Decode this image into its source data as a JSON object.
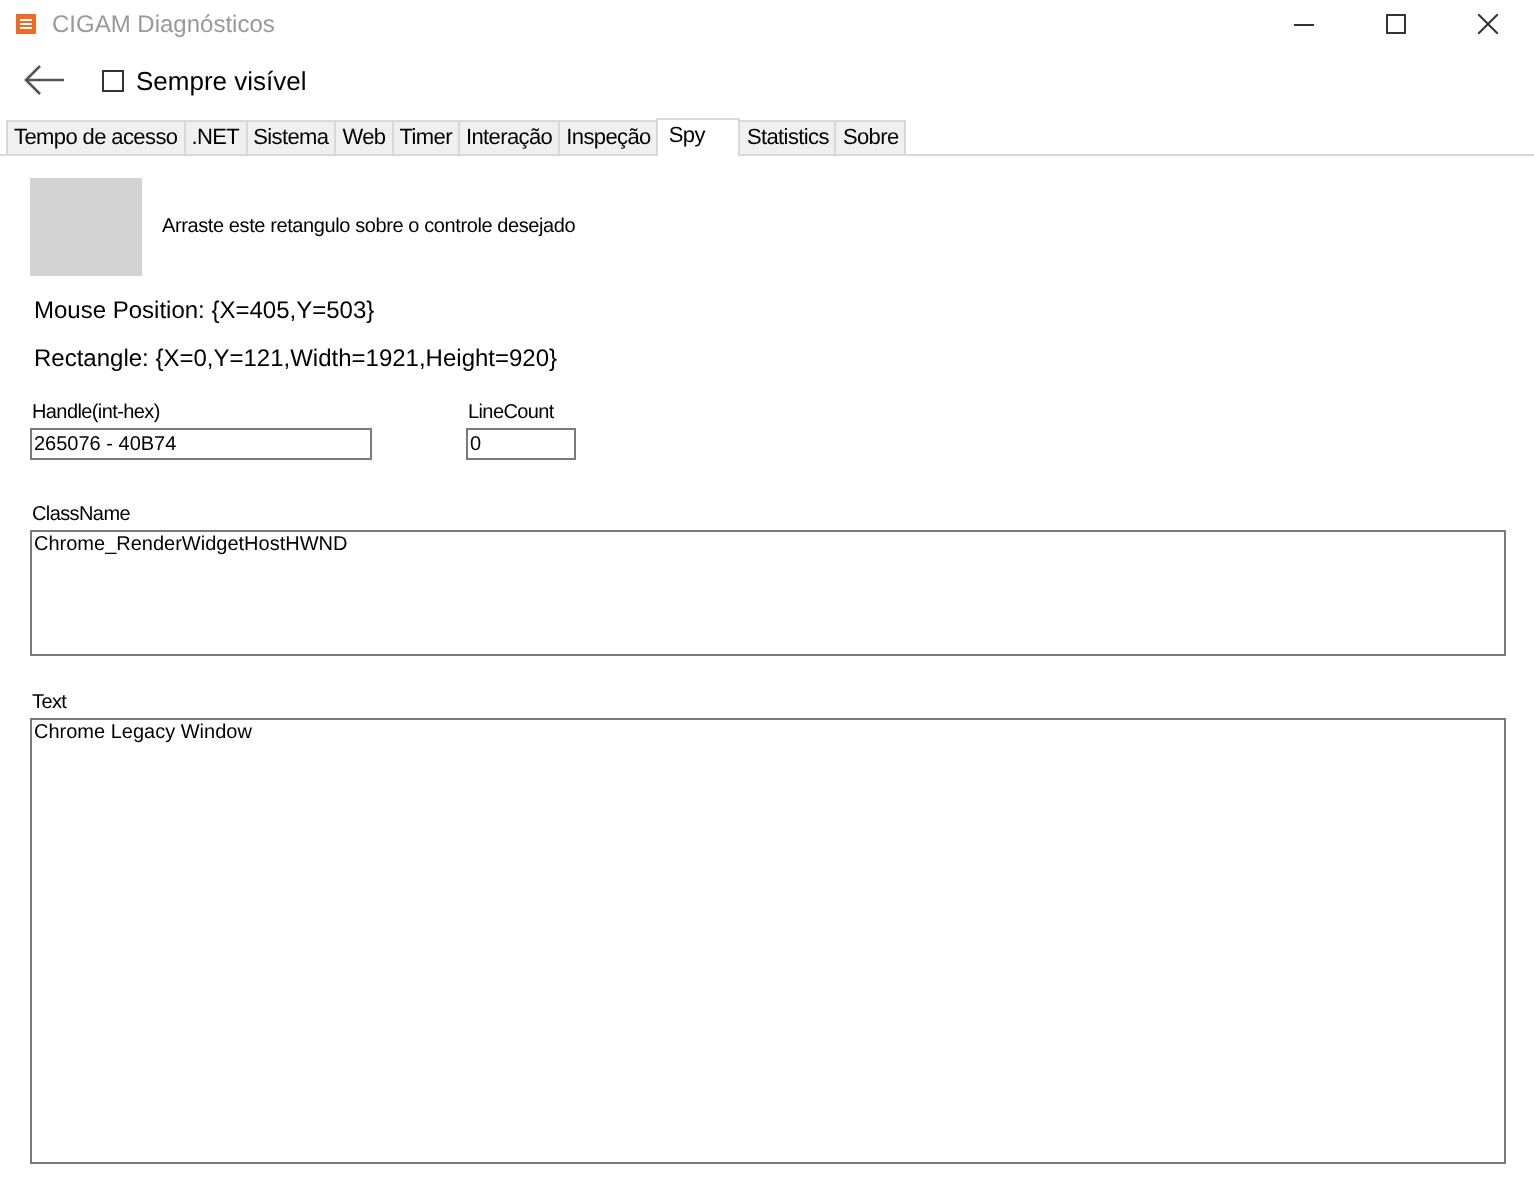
{
  "window": {
    "title": "CIGAM Diagnósticos"
  },
  "toolbar": {
    "always_visible": {
      "label": "Sempre visível",
      "checked": false
    }
  },
  "tabs": [
    {
      "label": "Tempo de acesso",
      "selected": false
    },
    {
      "label": ".NET",
      "selected": false
    },
    {
      "label": "Sistema",
      "selected": false
    },
    {
      "label": "Web",
      "selected": false
    },
    {
      "label": "Timer",
      "selected": false
    },
    {
      "label": "Interação",
      "selected": false
    },
    {
      "label": "Inspeção",
      "selected": false
    },
    {
      "label": "Spy",
      "selected": true
    },
    {
      "label": "Statistics",
      "selected": false
    },
    {
      "label": "Sobre",
      "selected": false
    }
  ],
  "spy": {
    "drag_hint": "Arraste este retangulo sobre o controle desejado",
    "mouse_position": "Mouse Position: {X=405,Y=503}",
    "rectangle": "Rectangle: {X=0,Y=121,Width=1921,Height=920}",
    "handle": {
      "label": "Handle(int-hex)",
      "value": "265076 - 40B74"
    },
    "line_count": {
      "label": "LineCount",
      "value": "0"
    },
    "class_name": {
      "label": "ClassName",
      "value": "Chrome_RenderWidgetHostHWND"
    },
    "text": {
      "label": "Text",
      "value": "Chrome Legacy Window"
    }
  }
}
